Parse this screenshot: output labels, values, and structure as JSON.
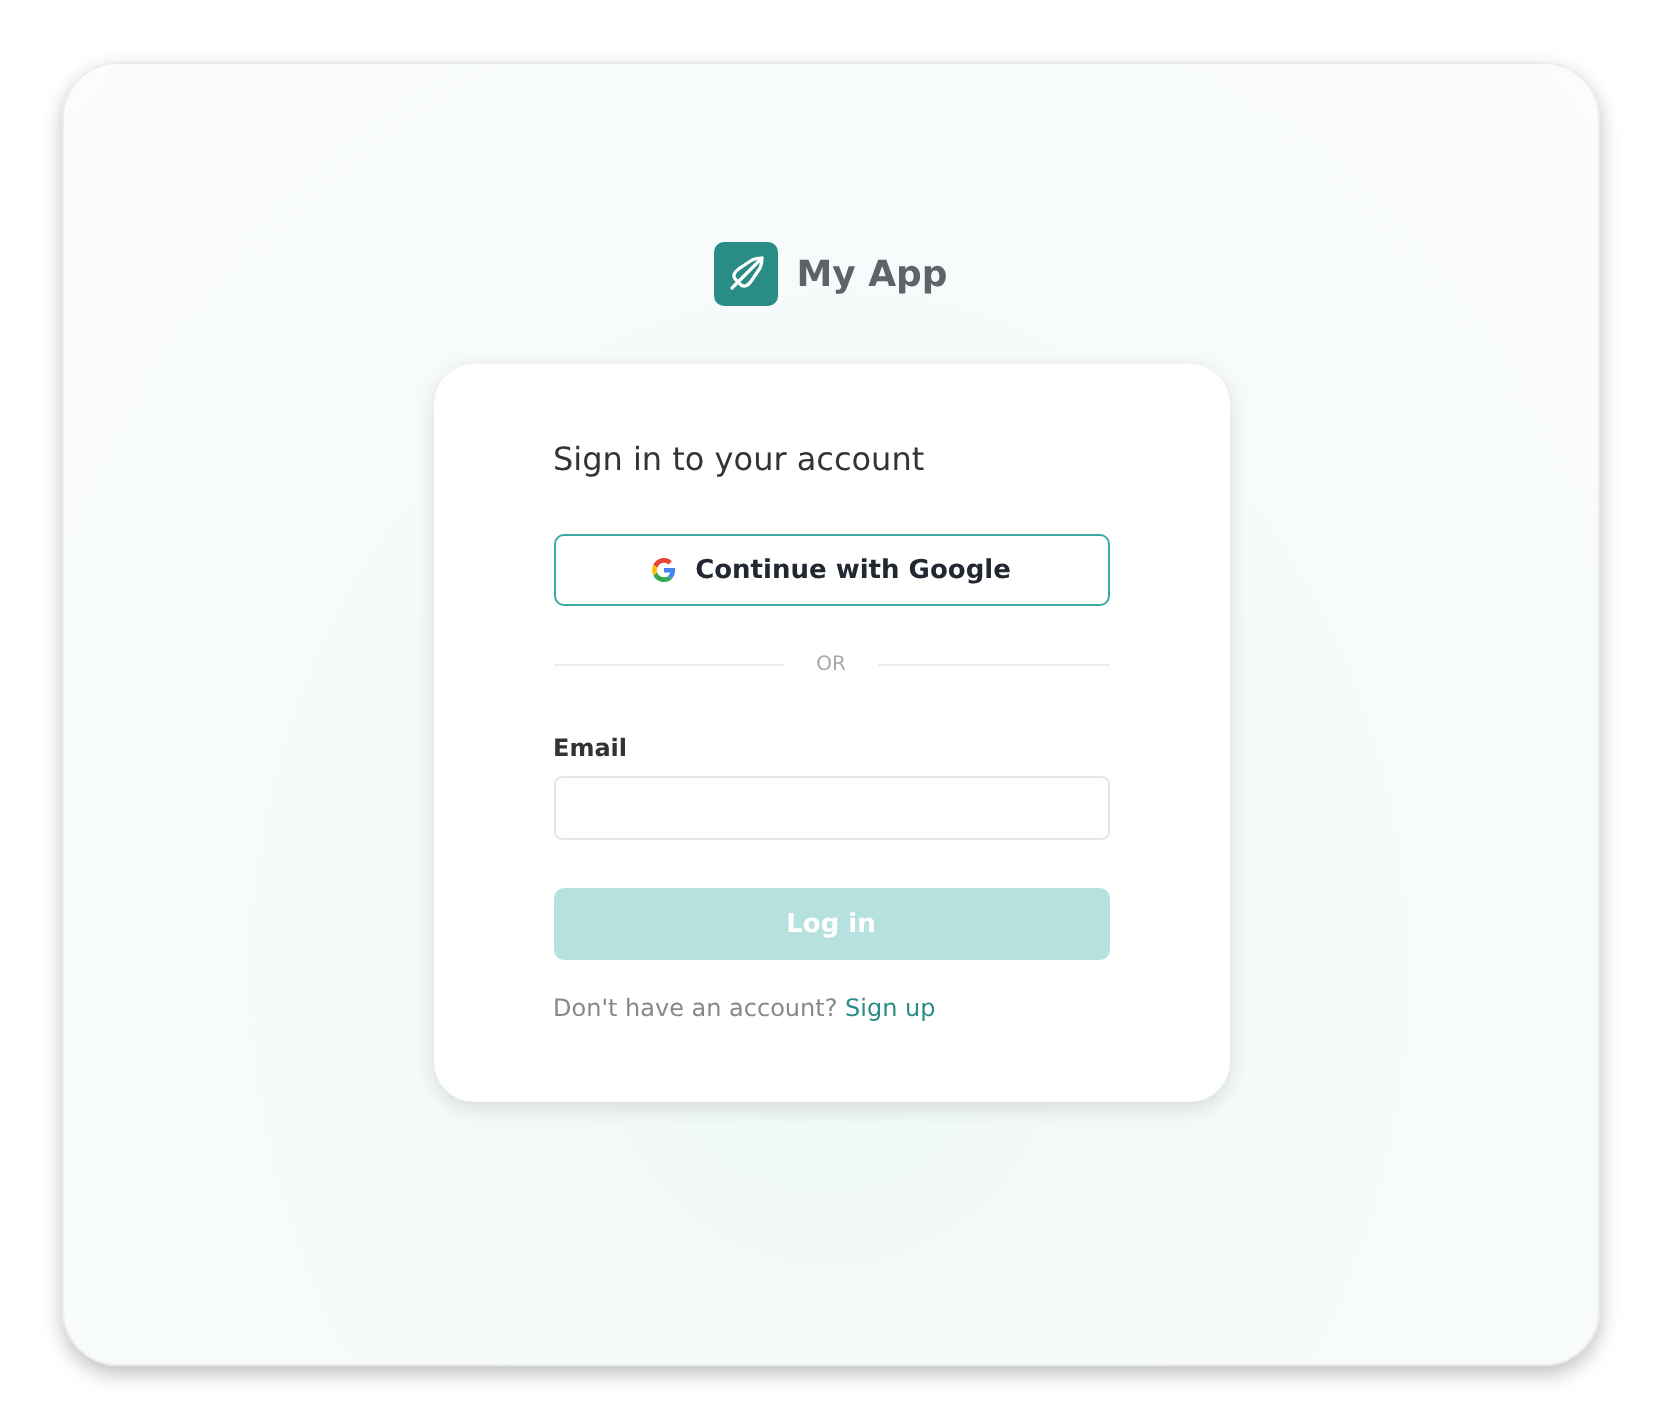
{
  "brand": {
    "name": "My App"
  },
  "card": {
    "title": "Sign in to your account",
    "google_button": {
      "label": "Continue with Google"
    },
    "divider": "OR",
    "email": {
      "label": "Email"
    },
    "login_button": {
      "label": "Log in",
      "disabled": true
    },
    "signup_prompt": {
      "text": "Don't have an account?",
      "link": "Sign up"
    }
  }
}
